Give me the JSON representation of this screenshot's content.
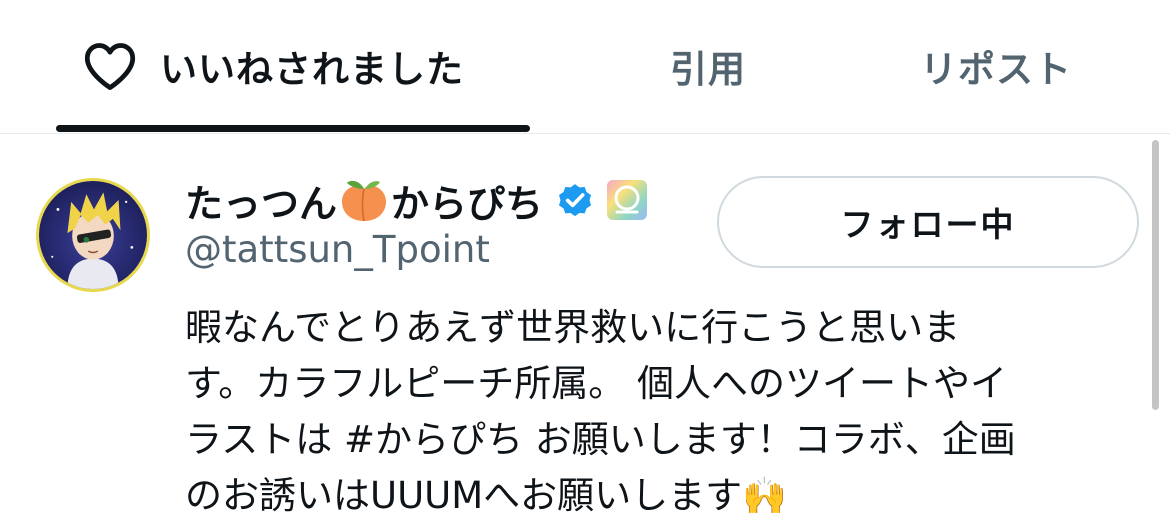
{
  "tabs": [
    {
      "label": "いいねされました",
      "icon": "heart-outline-icon",
      "active": true
    },
    {
      "label": "引用",
      "active": false
    },
    {
      "label": "リポスト",
      "active": false
    }
  ],
  "user": {
    "display_name_part1": "たっつん",
    "name_emoji": "peach-icon",
    "display_name_part2": "からぴち",
    "verified_icon": "verified-badge-icon",
    "affiliate_icon": "affiliate-badge-icon",
    "handle": "@tattsun_Tpoint",
    "follow_button_label": "フォロー中",
    "bio_lines": [
      "暇なんでとりあえず世界救いに行こうと思いま",
      "す。カラフルピーチ所属。 個人へのツイートやイ",
      "ラストは #からぴち お願いします！コラボ、企画",
      "のお誘いはUUUMへお願いします"
    ],
    "bio_end_emoji": "🙌"
  },
  "colors": {
    "accent": "#0f1419",
    "secondary_text": "#536471",
    "verified": "#1d9bf0",
    "avatar_ring": "#e7d84c"
  }
}
